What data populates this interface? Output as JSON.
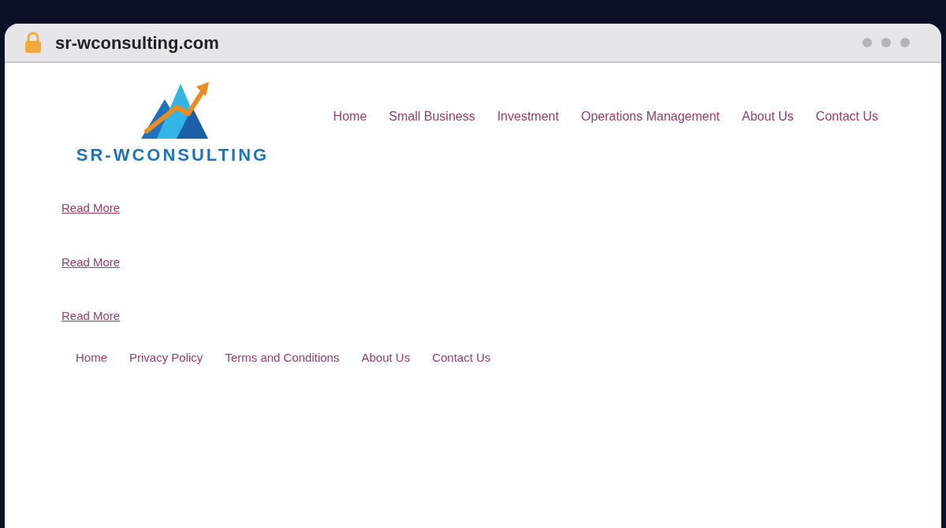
{
  "address_bar": {
    "url": "sr-wconsulting.com"
  },
  "logo": {
    "text": "SR-WCONSULTING"
  },
  "nav": [
    "Home",
    "Small Business",
    "Investment",
    "Operations Management",
    "About Us",
    "Contact Us"
  ],
  "read_more_links": [
    "Read More",
    "Read More",
    "Read More"
  ],
  "footer_nav": [
    "Home",
    "Privacy Policy",
    "Terms and Conditions",
    "About Us",
    "Contact Us"
  ]
}
